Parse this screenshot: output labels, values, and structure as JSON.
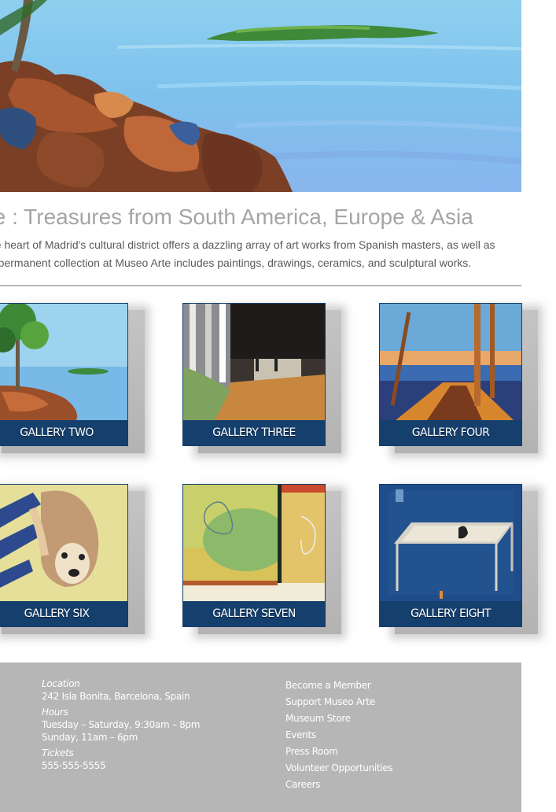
{
  "hero": {
    "alt": "Painting of a rocky shoreline with trees and a distant island"
  },
  "headline": "te : Treasures from South America, Europe & Asia",
  "intro": {
    "line1": "he heart of Madrid's cultural district offers a dazzling array of art works from Spanish masters, as well as",
    "line2": "e permanent collection at Museo Arte includes paintings, drawings, ceramics, and sculptural works."
  },
  "galleries": {
    "row1": [
      {
        "label": "GALLERY TWO"
      },
      {
        "label": "GALLERY THREE"
      },
      {
        "label": "GALLERY FOUR"
      }
    ],
    "row2": [
      {
        "label": "GALLERY SIX"
      },
      {
        "label": "GALLERY SEVEN"
      },
      {
        "label": "GALLERY EIGHT"
      }
    ]
  },
  "footer": {
    "location_label": "Location",
    "location_value": "242 Isla Bonita, Barcelona, Spain",
    "hours_label": "Hours",
    "hours_line1": "Tuesday – Saturday, 9:30am – 8pm",
    "hours_line2": "Sunday, 11am – 6pm",
    "tickets_label": "Tickets",
    "tickets_value": "555-555-5555",
    "links": [
      "Become a Member",
      "Support Museo Arte",
      "Museum Store",
      "Events",
      "Press Room",
      "Volunteer Opportunities",
      "Careers"
    ]
  },
  "colors": {
    "label_bar": "#153f6d",
    "footer_bg": "#b6b6b6",
    "headline": "#a5a5a5"
  }
}
